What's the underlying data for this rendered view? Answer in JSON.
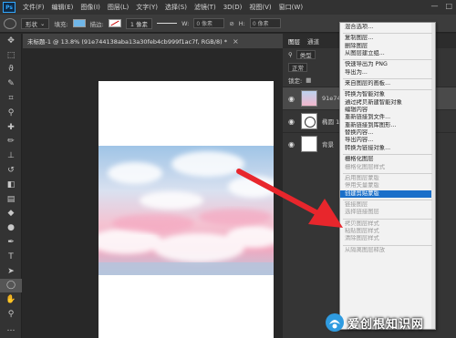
{
  "menubar": {
    "logo": "Ps",
    "items": [
      "文件(F)",
      "编辑(E)",
      "图像(I)",
      "图层(L)",
      "文字(Y)",
      "选择(S)",
      "滤镜(T)",
      "3D(D)",
      "视图(V)",
      "窗口(W)"
    ]
  },
  "options": {
    "mode": "形状",
    "fill_label": "填充:",
    "stroke_label": "描边:",
    "stroke_width": "1 像素",
    "w_label": "W:",
    "w_value": "0 像素",
    "h_label": "H:",
    "h_value": "0 像素"
  },
  "document": {
    "tab_title": "未标题-1 @ 13.8% (91e744138aba13a30feb4cb999f1ac7f, RGB/8) *"
  },
  "layers_panel": {
    "tabs": [
      "图层",
      "通道"
    ],
    "kind_label": "类型",
    "blend_mode": "正常",
    "lock_label": "锁定:",
    "layers": [
      {
        "name": "91e744"
      },
      {
        "name": "椭圆 1"
      },
      {
        "name": "背景"
      }
    ]
  },
  "context_menu": {
    "groups": [
      [
        {
          "label": "混合选项...",
          "enabled": true
        }
      ],
      [
        {
          "label": "复制图层...",
          "enabled": true
        },
        {
          "label": "删除图层",
          "enabled": true
        },
        {
          "label": "从图层建立组...",
          "enabled": true
        }
      ],
      [
        {
          "label": "快速导出为 PNG",
          "enabled": true
        },
        {
          "label": "导出为...",
          "enabled": true
        }
      ],
      [
        {
          "label": "来自图层的画板...",
          "enabled": true
        }
      ],
      [
        {
          "label": "转换为智能对象",
          "enabled": true
        },
        {
          "label": "通过拷贝新建智能对象",
          "enabled": true
        },
        {
          "label": "编辑内容",
          "enabled": true
        },
        {
          "label": "重新链接到文件...",
          "enabled": true
        },
        {
          "label": "重新链接到库图形...",
          "enabled": true
        },
        {
          "label": "替换内容...",
          "enabled": true
        },
        {
          "label": "导出内容...",
          "enabled": true
        },
        {
          "label": "转换为链接对象...",
          "enabled": true
        }
      ],
      [
        {
          "label": "栅格化图层",
          "enabled": true
        },
        {
          "label": "栅格化图层样式",
          "enabled": false
        }
      ],
      [
        {
          "label": "启用图层蒙版",
          "enabled": false
        },
        {
          "label": "停用矢量蒙版",
          "enabled": false
        },
        {
          "label": "创建剪贴蒙版",
          "enabled": true,
          "highlighted": true
        }
      ],
      [
        {
          "label": "链接图层",
          "enabled": false
        },
        {
          "label": "选择链接图层",
          "enabled": false
        }
      ],
      [
        {
          "label": "拷贝图层样式",
          "enabled": false
        },
        {
          "label": "粘贴图层样式",
          "enabled": false
        },
        {
          "label": "清除图层样式",
          "enabled": false
        }
      ],
      [
        {
          "label": "从隔离图层释放",
          "enabled": false
        }
      ]
    ]
  },
  "watermark": {
    "text": "爱创根知识网"
  },
  "colors": {
    "highlight": "#1a6fc9",
    "arrow": "#e8262c",
    "fill_swatch": "#6fb6e8"
  }
}
